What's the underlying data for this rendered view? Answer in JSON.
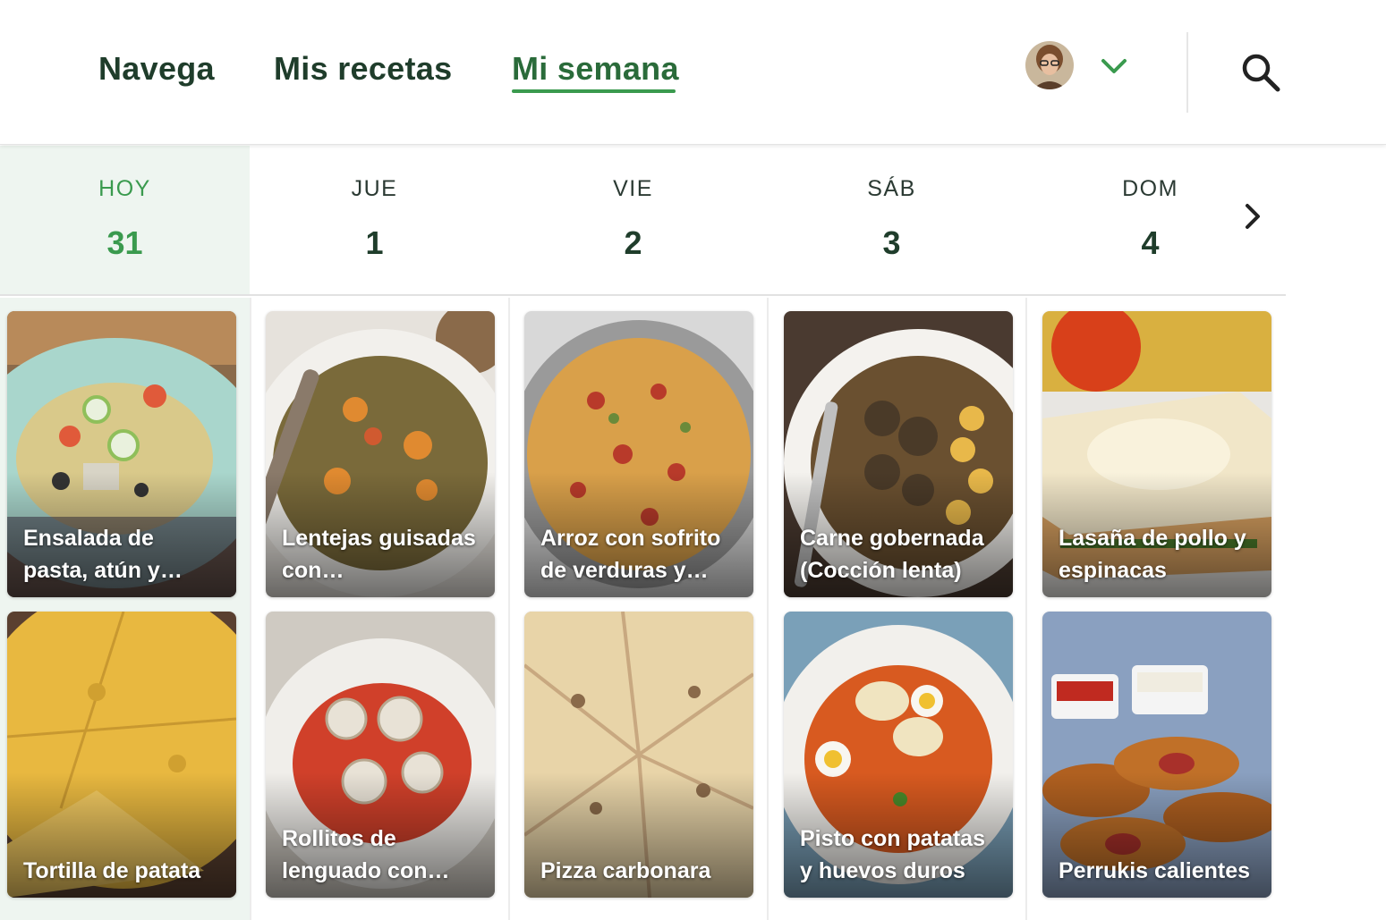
{
  "nav": {
    "tabs": [
      {
        "label": "Navega"
      },
      {
        "label": "Mis recetas"
      },
      {
        "label": "Mi semana"
      }
    ],
    "active_tab": "Mi semana"
  },
  "header_icons": {
    "avatar": "user-avatar",
    "menu": "chevron-down-icon",
    "search": "search-icon"
  },
  "days": [
    {
      "name": "HOY",
      "number": "31",
      "today": true
    },
    {
      "name": "JUE",
      "number": "1"
    },
    {
      "name": "VIE",
      "number": "2"
    },
    {
      "name": "SÁB",
      "number": "3"
    },
    {
      "name": "DOM",
      "number": "4"
    }
  ],
  "next_icon": "chevron-right-icon",
  "meals": {
    "lunch": [
      {
        "title": "Ensalada de pasta, atún y…"
      },
      {
        "title": "Lentejas guisadas con…"
      },
      {
        "title": "Arroz con sofrito de verduras y…"
      },
      {
        "title": "Carne gobernada (Cocción lenta)"
      },
      {
        "title": "Lasaña de pollo y espinacas"
      }
    ],
    "dinner": [
      {
        "title": "Tortilla de patata"
      },
      {
        "title": "Rollitos de lenguado con…"
      },
      {
        "title": "Pizza carbonara"
      },
      {
        "title": "Pisto con patatas y huevos duros"
      },
      {
        "title": "Perrukis calientes"
      }
    ]
  },
  "colors": {
    "accent": "#3a9a4e",
    "text_dark": "#1f3d2b",
    "today_bg": "#eef5f0"
  }
}
